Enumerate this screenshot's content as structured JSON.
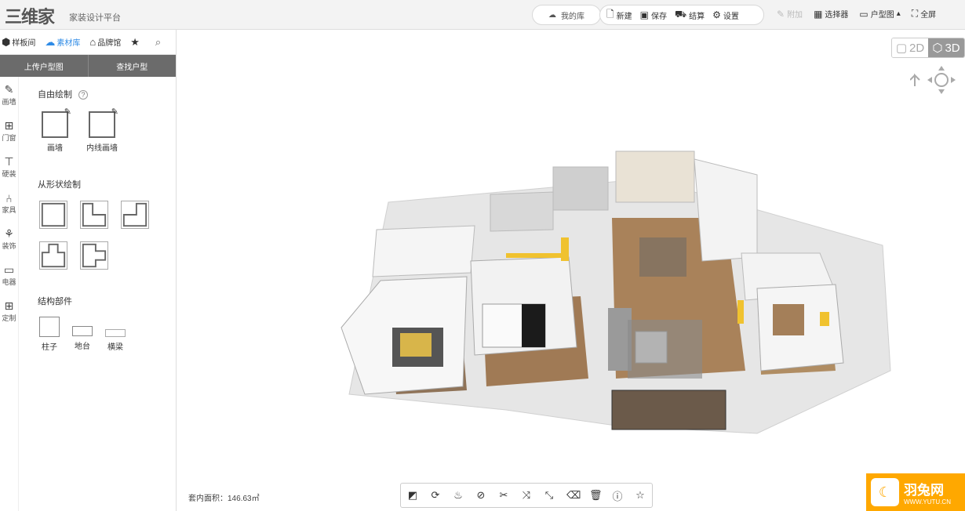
{
  "app": {
    "logo": "三维家",
    "subtitle": "家装设计平台"
  },
  "toolbar": {
    "my_library": "我的库",
    "new": "新建",
    "save": "保存",
    "checkout": "结算",
    "settings": "设置",
    "attach": "附加",
    "selector": "选择器",
    "floorplan": "户型图",
    "fullscreen": "全屏"
  },
  "left": {
    "lib_tabs": [
      "样板间",
      "素材库",
      "品牌馆"
    ],
    "upload_plan": "上传户型图",
    "find_plan": "查找户型",
    "categories": [
      "画墙",
      "门窗",
      "硬装",
      "家具",
      "装饰",
      "电器",
      "定制"
    ],
    "sec_free": "自由绘制",
    "free_tools": [
      "画墙",
      "内线画墙"
    ],
    "sec_shape": "从形状绘制",
    "sec_struct": "结构部件",
    "struct_tools": [
      "柱子",
      "地台",
      "横梁"
    ]
  },
  "viewport": {
    "view_2d": "2D",
    "view_3d": "3D",
    "area_label": "套内面积：146.63㎡"
  },
  "watermark": {
    "name": "羽兔网",
    "url": "WWW.YUTU.CN"
  },
  "colors": {
    "accent": "#2e8be6",
    "upload_bar": "#6b6b6b",
    "watermark": "#ffa800"
  }
}
